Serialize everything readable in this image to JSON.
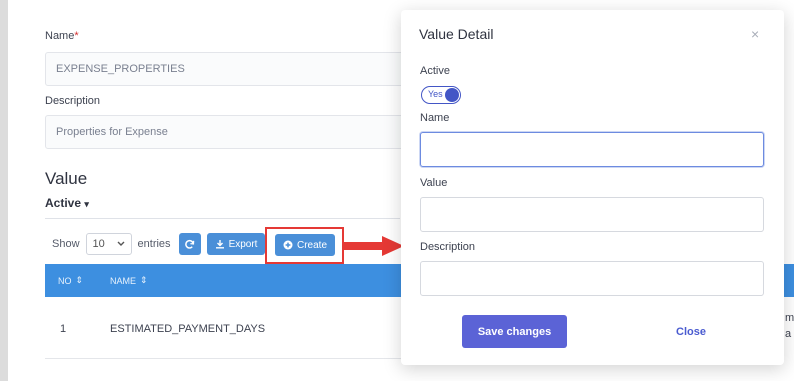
{
  "form": {
    "name_label": "Name",
    "required_mark": "*",
    "name_value": "EXPENSE_PROPERTIES",
    "description_label": "Description",
    "description_value": "Properties for Expense"
  },
  "value_section": {
    "title": "Value",
    "tab_active": "Active",
    "tab_caret": "▾"
  },
  "toolbar": {
    "show_label": "Show",
    "entries_value": "10",
    "entries_label": "entries",
    "refresh_icon": "refresh-icon",
    "export_label": "Export",
    "create_label": "Create"
  },
  "table": {
    "headers": [
      "NO",
      "NAME"
    ],
    "sort_glyph": "⇕",
    "rows": [
      {
        "no": "1",
        "name": "ESTIMATED_PAYMENT_DAYS"
      }
    ],
    "right_fragment_1": "m",
    "right_fragment_2": "a"
  },
  "modal": {
    "title": "Value Detail",
    "close_glyph": "×",
    "active_label": "Active",
    "toggle_text": "Yes",
    "name_label": "Name",
    "name_value": "",
    "value_label": "Value",
    "value_value": "",
    "description_label": "Description",
    "description_value": "",
    "save_label": "Save changes",
    "close_label": "Close"
  },
  "colors": {
    "table_header": "#3d8fe0",
    "primary_button": "#5b63d6",
    "highlight_red": "#e53935",
    "toggle_on": "#4356c6"
  }
}
